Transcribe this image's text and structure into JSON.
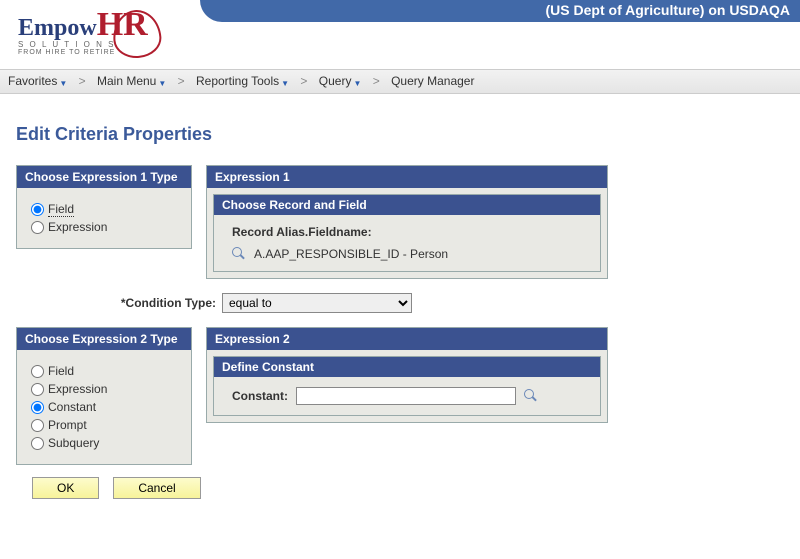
{
  "header": {
    "title": "(US Dept of Agriculture) on USDAQA",
    "logo_main": "Empow",
    "logo_hr": "HR",
    "logo_sub1": "S O L U T I O N S",
    "logo_sub2": "FROM HIRE TO RETIRE"
  },
  "breadcrumb": {
    "items": [
      "Favorites",
      "Main Menu",
      "Reporting Tools",
      "Query",
      "Query Manager"
    ]
  },
  "page_title": "Edit Criteria Properties",
  "exp1type": {
    "header": "Choose Expression 1 Type",
    "options": [
      "Field",
      "Expression"
    ],
    "selected": "Field"
  },
  "exp1": {
    "header": "Expression 1",
    "inner_header": "Choose Record and Field",
    "label": "Record Alias.Fieldname:",
    "value": "A.AAP_RESPONSIBLE_ID - Person"
  },
  "condition": {
    "label": "*Condition Type:",
    "value": "equal to"
  },
  "exp2type": {
    "header": "Choose Expression 2 Type",
    "options": [
      "Field",
      "Expression",
      "Constant",
      "Prompt",
      "Subquery"
    ],
    "selected": "Constant"
  },
  "exp2": {
    "header": "Expression 2",
    "inner_header": "Define Constant",
    "label": "Constant:",
    "value": ""
  },
  "buttons": {
    "ok": "OK",
    "cancel": "Cancel"
  }
}
